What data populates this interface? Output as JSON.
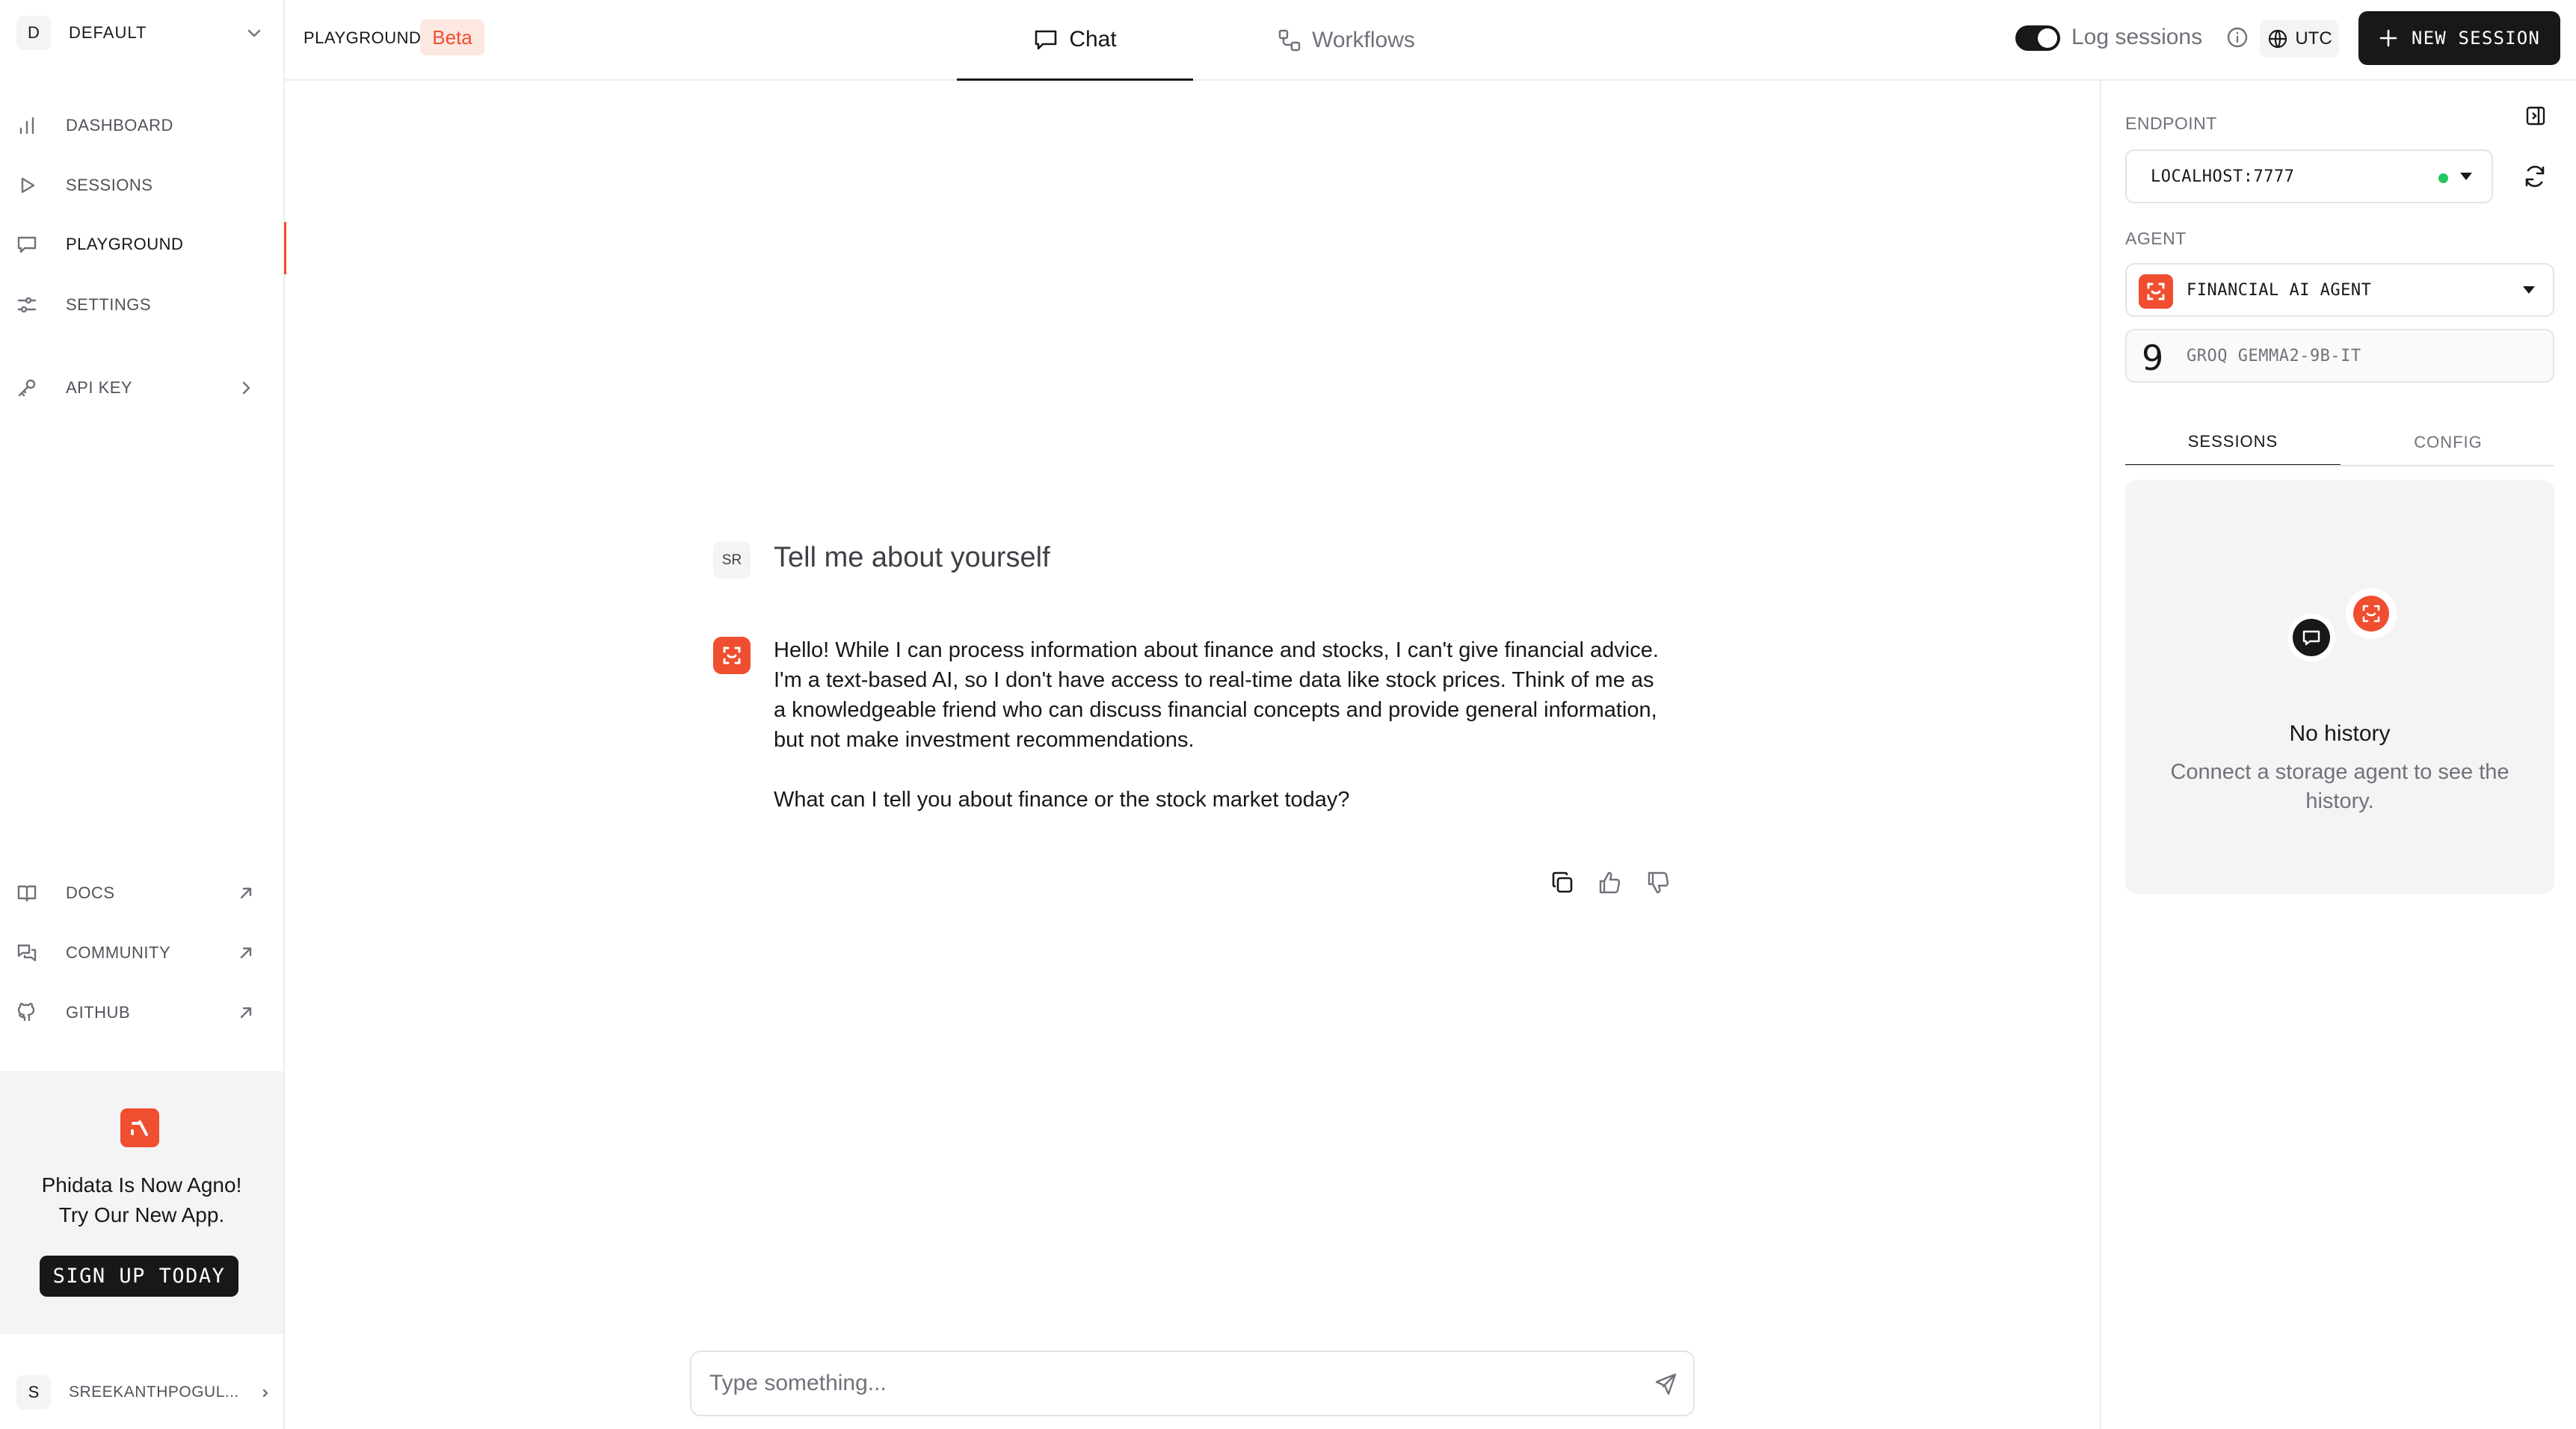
{
  "workspace": {
    "initial": "D",
    "name": "DEFAULT"
  },
  "nav": [
    {
      "label": "DASHBOARD",
      "icon": "bar-chart-icon"
    },
    {
      "label": "SESSIONS",
      "icon": "play-icon"
    },
    {
      "label": "PLAYGROUND",
      "icon": "message-square-icon",
      "active": true
    },
    {
      "label": "SETTINGS",
      "icon": "sliders-icon"
    },
    {
      "label": "API KEY",
      "icon": "key-icon"
    }
  ],
  "links": [
    {
      "label": "DOCS",
      "icon": "book-icon"
    },
    {
      "label": "COMMUNITY",
      "icon": "messages-icon"
    },
    {
      "label": "GITHUB",
      "icon": "github-icon"
    }
  ],
  "promo": {
    "line1": "Phidata Is Now Agno!",
    "line2": "Try Our New App.",
    "button": "SIGN UP TODAY"
  },
  "user": {
    "initial": "S",
    "name": "SREEKANTHPOGUL..."
  },
  "topbar": {
    "section": "PLAYGROUND",
    "badge": "Beta",
    "tabs": [
      {
        "label": "Chat",
        "active": true
      },
      {
        "label": "Workflows",
        "active": false
      }
    ],
    "log_sessions_label": "Log sessions",
    "log_sessions_on": true,
    "timezone": "UTC",
    "new_session": "NEW SESSION"
  },
  "chat": {
    "user_initials": "SR",
    "question": "Tell me about yourself",
    "answer_p1": "Hello! While I can process information about finance and stocks, I can't give financial advice. I'm a text-based AI, so I don't have access to real-time data like stock prices. Think of me as a knowledgeable friend who can discuss financial concepts and provide general information, but not make investment recommendations.",
    "answer_p2": "What can I tell you about finance or the stock market today?",
    "input_placeholder": "Type something..."
  },
  "panel": {
    "endpoint_label": "ENDPOINT",
    "endpoint_value": "LOCALHOST:7777",
    "endpoint_status_color": "#22c55e",
    "agent_label": "AGENT",
    "agent_value": "FINANCIAL AI AGENT",
    "model": "GROQ GEMMA2-9B-IT",
    "tabs": [
      {
        "label": "SESSIONS",
        "active": true
      },
      {
        "label": "CONFIG",
        "active": false
      }
    ],
    "history_title": "No history",
    "history_desc": "Connect a storage agent to see the history."
  },
  "colors": {
    "accent": "#f04e30",
    "dark": "#18181b",
    "muted": "#71717a"
  }
}
